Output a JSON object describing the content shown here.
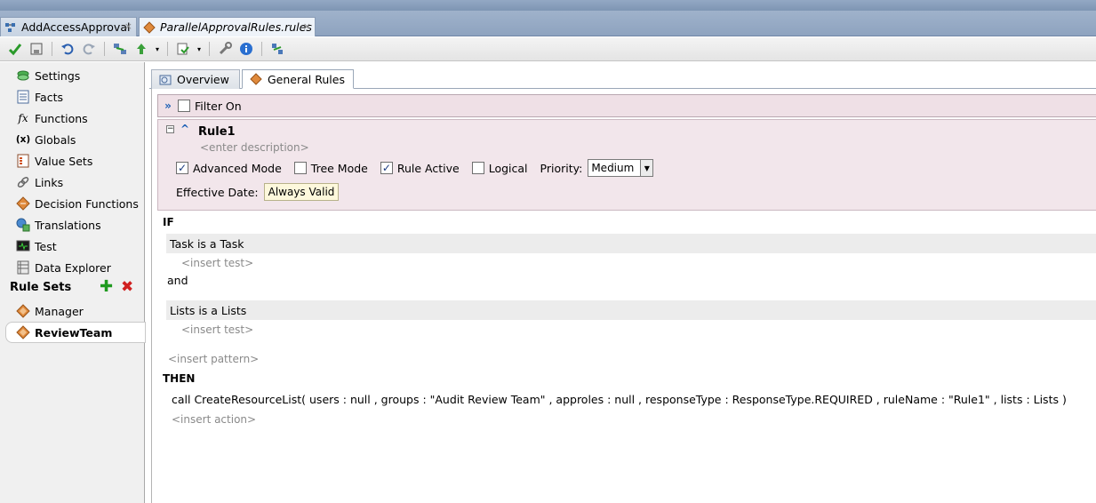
{
  "doc_tabs": [
    {
      "label": "AddAccessApproval",
      "close": "×"
    },
    {
      "label": "ParallelApprovalRules.rules",
      "close": "×"
    }
  ],
  "toolbar": {
    "icons": [
      "validate-check-icon",
      "save-all-icon",
      "undo-icon",
      "redo-icon",
      "navigate-icon",
      "up-icon",
      "export-icon",
      "tools-icon",
      "info-icon",
      "deploy-icon"
    ]
  },
  "nav": {
    "items": [
      {
        "label": "Settings",
        "icon": "settings-icon"
      },
      {
        "label": "Facts",
        "icon": "facts-icon"
      },
      {
        "label": "Functions",
        "icon": "functions-icon",
        "glyph": "fx"
      },
      {
        "label": "Globals",
        "icon": "globals-icon",
        "glyph": "(x)"
      },
      {
        "label": "Value Sets",
        "icon": "value-sets-icon"
      },
      {
        "label": "Links",
        "icon": "links-icon"
      },
      {
        "label": "Decision Functions",
        "icon": "decision-functions-icon"
      },
      {
        "label": "Translations",
        "icon": "translations-icon"
      },
      {
        "label": "Test",
        "icon": "test-icon"
      },
      {
        "label": "Data Explorer",
        "icon": "data-explorer-icon"
      }
    ],
    "rule_sets_label": "Rule Sets",
    "rule_sets": [
      {
        "label": "Manager"
      },
      {
        "label": "ReviewTeam"
      }
    ]
  },
  "main_tabs": [
    {
      "label": "Overview"
    },
    {
      "label": "General Rules"
    }
  ],
  "filter": {
    "label": "Filter On",
    "checked": false
  },
  "rule": {
    "name": "Rule1",
    "description_placeholder": "<enter description>",
    "advanced_mode": {
      "label": "Advanced Mode",
      "checked": true
    },
    "tree_mode": {
      "label": "Tree Mode",
      "checked": false
    },
    "rule_active": {
      "label": "Rule Active",
      "checked": true
    },
    "logical": {
      "label": "Logical",
      "checked": false
    },
    "priority_label": "Priority:",
    "priority_value": "Medium",
    "effective_date_label": "Effective Date:",
    "effective_date_value": "Always Valid"
  },
  "body": {
    "if_kw": "IF",
    "pattern1": "Task is a Task",
    "insert_test1": "<insert test>",
    "and_kw": "and",
    "pattern2": "Lists is a Lists",
    "insert_test2": "<insert test>",
    "insert_pattern": "<insert pattern>",
    "then_kw": "THEN",
    "action": "call CreateResourceList( users : null , groups : \"Audit Review Team\" , approles : null , responseType : ResponseType.REQUIRED , ruleName : \"Rule1\" , lists : Lists )",
    "insert_action": "<insert action>"
  }
}
